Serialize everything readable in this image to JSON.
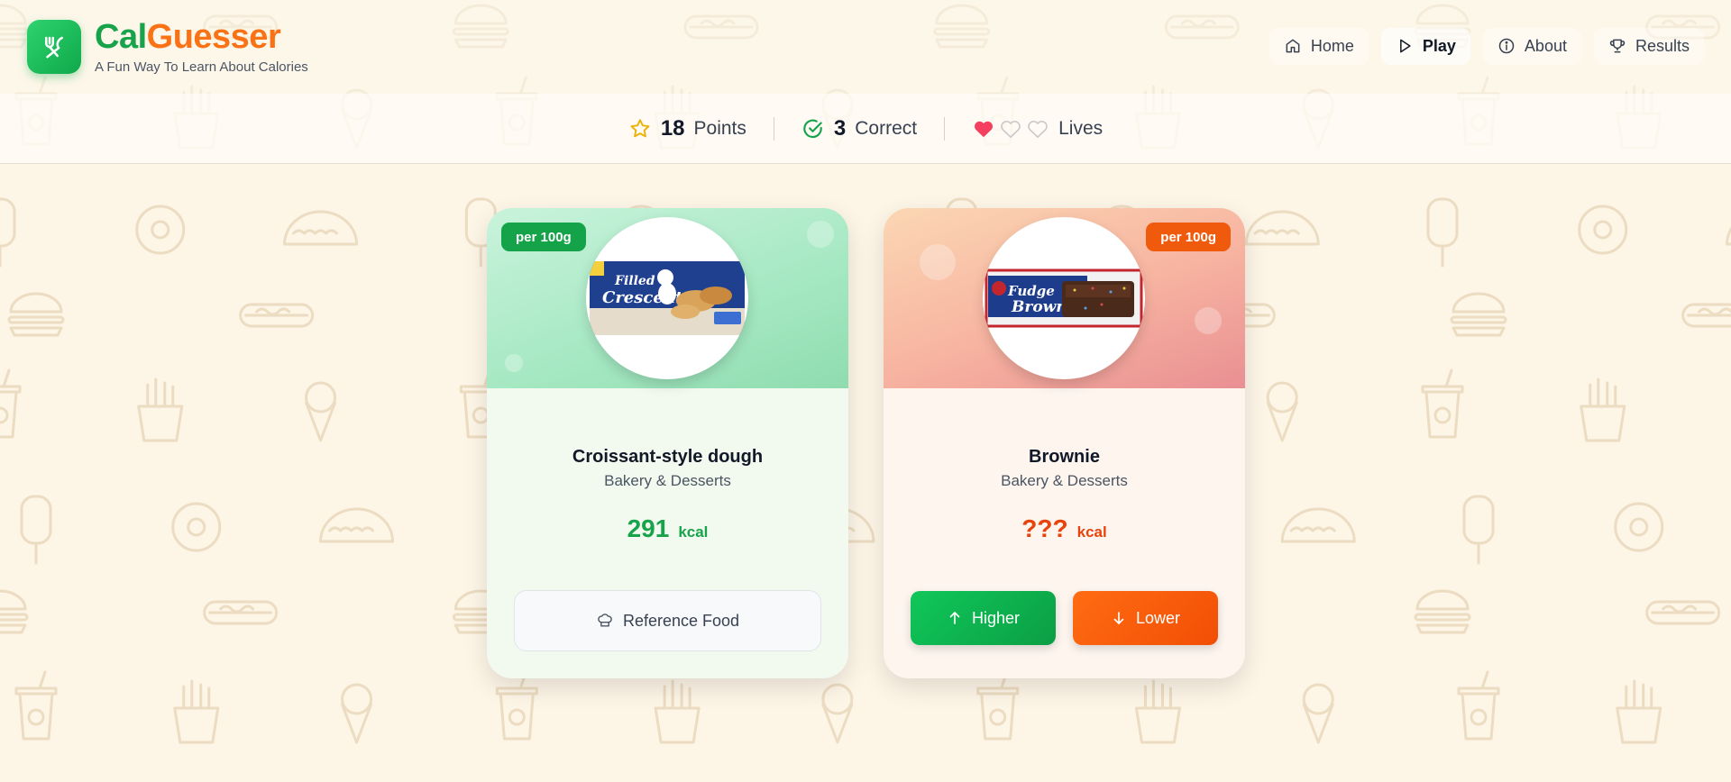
{
  "brand": {
    "part1": "Cal",
    "part2": "Guesser",
    "tagline": "A Fun Way To Learn About Calories",
    "logo_icon": "fork-knife-icon"
  },
  "nav": [
    {
      "label": "Home",
      "icon": "home-icon",
      "active": false
    },
    {
      "label": "Play",
      "icon": "play-icon",
      "active": true
    },
    {
      "label": "About",
      "icon": "info-icon",
      "active": false
    },
    {
      "label": "Results",
      "icon": "trophy-icon",
      "active": false
    }
  ],
  "stats": {
    "points": {
      "value": "18",
      "label": "Points"
    },
    "correct": {
      "value": "3",
      "label": "Correct"
    },
    "lives": {
      "label": "Lives",
      "filled": 1,
      "total": 3
    }
  },
  "reference_card": {
    "badge": "per 100g",
    "name": "Croissant-style dough",
    "category": "Bakery & Desserts",
    "kcal_value": "291",
    "kcal_unit": "kcal",
    "button_label": "Reference Food"
  },
  "guess_card": {
    "badge": "per 100g",
    "name": "Brownie",
    "category": "Bakery & Desserts",
    "kcal_value": "???",
    "kcal_unit": "kcal",
    "higher_label": "Higher",
    "lower_label": "Lower"
  },
  "colors": {
    "green": "#16a34a",
    "orange": "#f97316",
    "background": "#fdf5e6",
    "heart": "#f43f5e"
  }
}
